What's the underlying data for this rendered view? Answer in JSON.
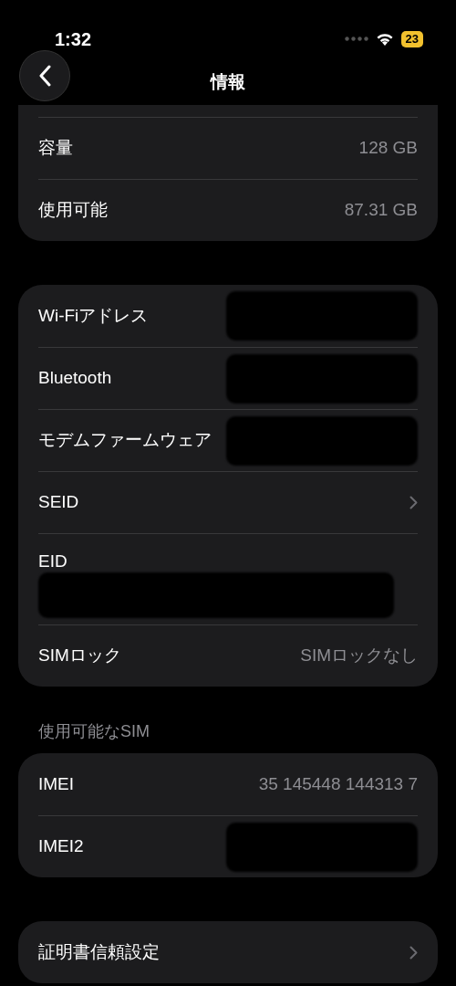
{
  "status_bar": {
    "time": "1:32",
    "battery": "23"
  },
  "nav": {
    "title": "情報"
  },
  "groups": [
    {
      "rows": [
        {
          "kind": "value",
          "label": "容量",
          "value": "128 GB"
        },
        {
          "kind": "value",
          "label": "使用可能",
          "value": "87.31 GB"
        }
      ]
    },
    {
      "rows": [
        {
          "kind": "redacted",
          "label": "Wi-Fiアドレス"
        },
        {
          "kind": "redacted",
          "label": "Bluetooth"
        },
        {
          "kind": "redacted",
          "label": "モデムファームウェア"
        },
        {
          "kind": "chevron",
          "label": "SEID"
        },
        {
          "kind": "stacked",
          "label": "EID"
        },
        {
          "kind": "value",
          "label": "SIMロック",
          "value": "SIMロックなし"
        }
      ]
    },
    {
      "header": "使用可能なSIM",
      "rows": [
        {
          "kind": "value",
          "label": "IMEI",
          "value": "35 145448 144313 7"
        },
        {
          "kind": "redacted",
          "label": "IMEI2"
        }
      ]
    },
    {
      "rows": [
        {
          "kind": "chevron",
          "label": "証明書信頼設定"
        }
      ]
    }
  ]
}
